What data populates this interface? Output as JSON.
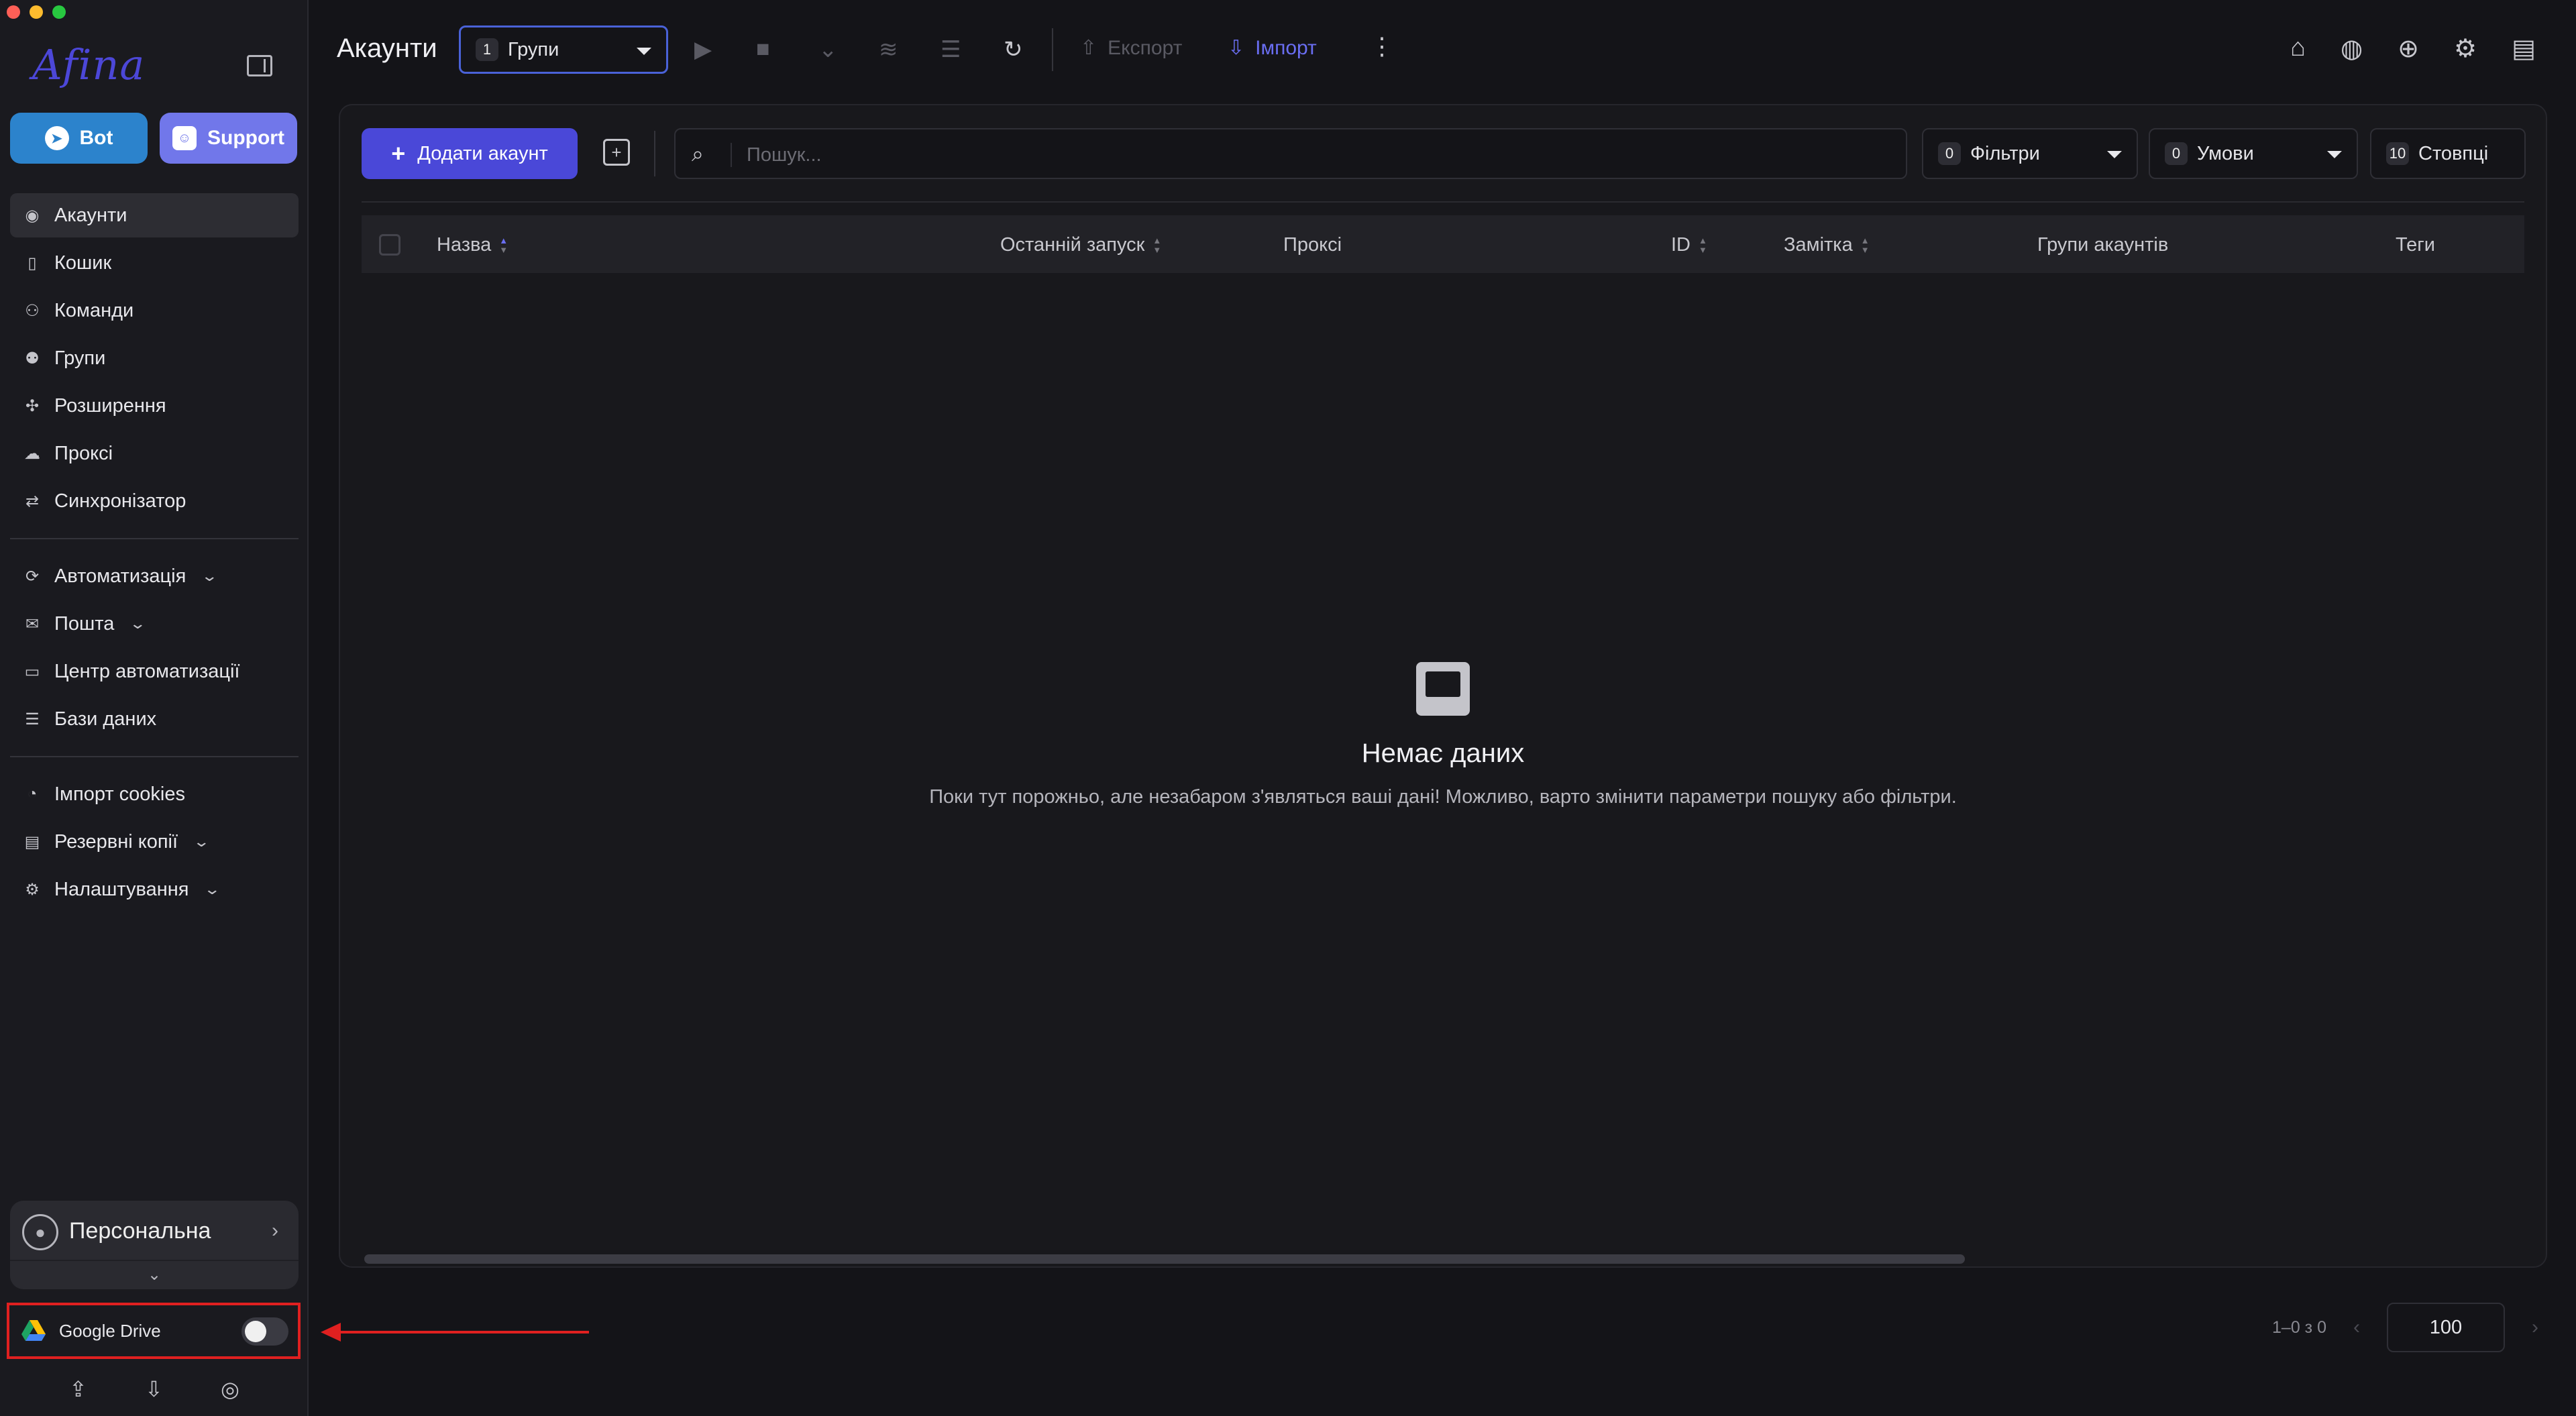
{
  "sidebar": {
    "logo": "Afina",
    "bot_label": "Bot",
    "support_label": "Support",
    "nav_primary": [
      {
        "label": "Акаунти",
        "icon": "user-circle-icon",
        "active": true
      },
      {
        "label": "Кошик",
        "icon": "trash-icon"
      },
      {
        "label": "Команди",
        "icon": "team-icon"
      },
      {
        "label": "Групи",
        "icon": "group-icon"
      },
      {
        "label": "Розширення",
        "icon": "puzzle-icon"
      },
      {
        "label": "Проксі",
        "icon": "cloud-icon"
      },
      {
        "label": "Синхронізатор",
        "icon": "sync-icon"
      }
    ],
    "nav_secondary": [
      {
        "label": "Автоматизація",
        "icon": "automation-icon",
        "expandable": true
      },
      {
        "label": "Пошта",
        "icon": "mail-icon",
        "expandable": true
      },
      {
        "label": "Центр автоматизації",
        "icon": "laptop-icon"
      },
      {
        "label": "Бази даних",
        "icon": "list-icon"
      }
    ],
    "nav_tertiary": [
      {
        "label": "Імпорт cookies",
        "icon": "cookie-icon"
      },
      {
        "label": "Резервні копії",
        "icon": "backup-icon",
        "expandable": true
      },
      {
        "label": "Налаштування",
        "icon": "settings-icon",
        "expandable": true
      }
    ],
    "workspace": "Персональна",
    "gdrive_label": "Google Drive",
    "gdrive_enabled": false
  },
  "topbar": {
    "title": "Акаунти",
    "group_count": "1",
    "group_label": "Групи",
    "export_label": "Експорт",
    "import_label": "Імпорт"
  },
  "toolbar": {
    "add_label": "Додати акаунт",
    "search_placeholder": "Пошук...",
    "filters_count": "0",
    "filters_label": "Фільтри",
    "conditions_count": "0",
    "conditions_label": "Умови",
    "columns_count": "10",
    "columns_label": "Стовпці"
  },
  "table": {
    "columns": [
      "Назва",
      "Останній запуск",
      "Проксі",
      "ID",
      "Замітка",
      "Групи акаунтів",
      "Теги"
    ]
  },
  "empty": {
    "title": "Немає даних",
    "text": "Поки тут порожньо, але незабаром з'являться ваші дані! Можливо, варто змінити параметри пошуку або фільтри."
  },
  "pager": {
    "info": "1–0 з 0",
    "page_size": "100"
  },
  "colors": {
    "accent": "#4a48d8",
    "bot": "#2c83cc",
    "support": "#7177ea",
    "highlight": "#e02020"
  }
}
